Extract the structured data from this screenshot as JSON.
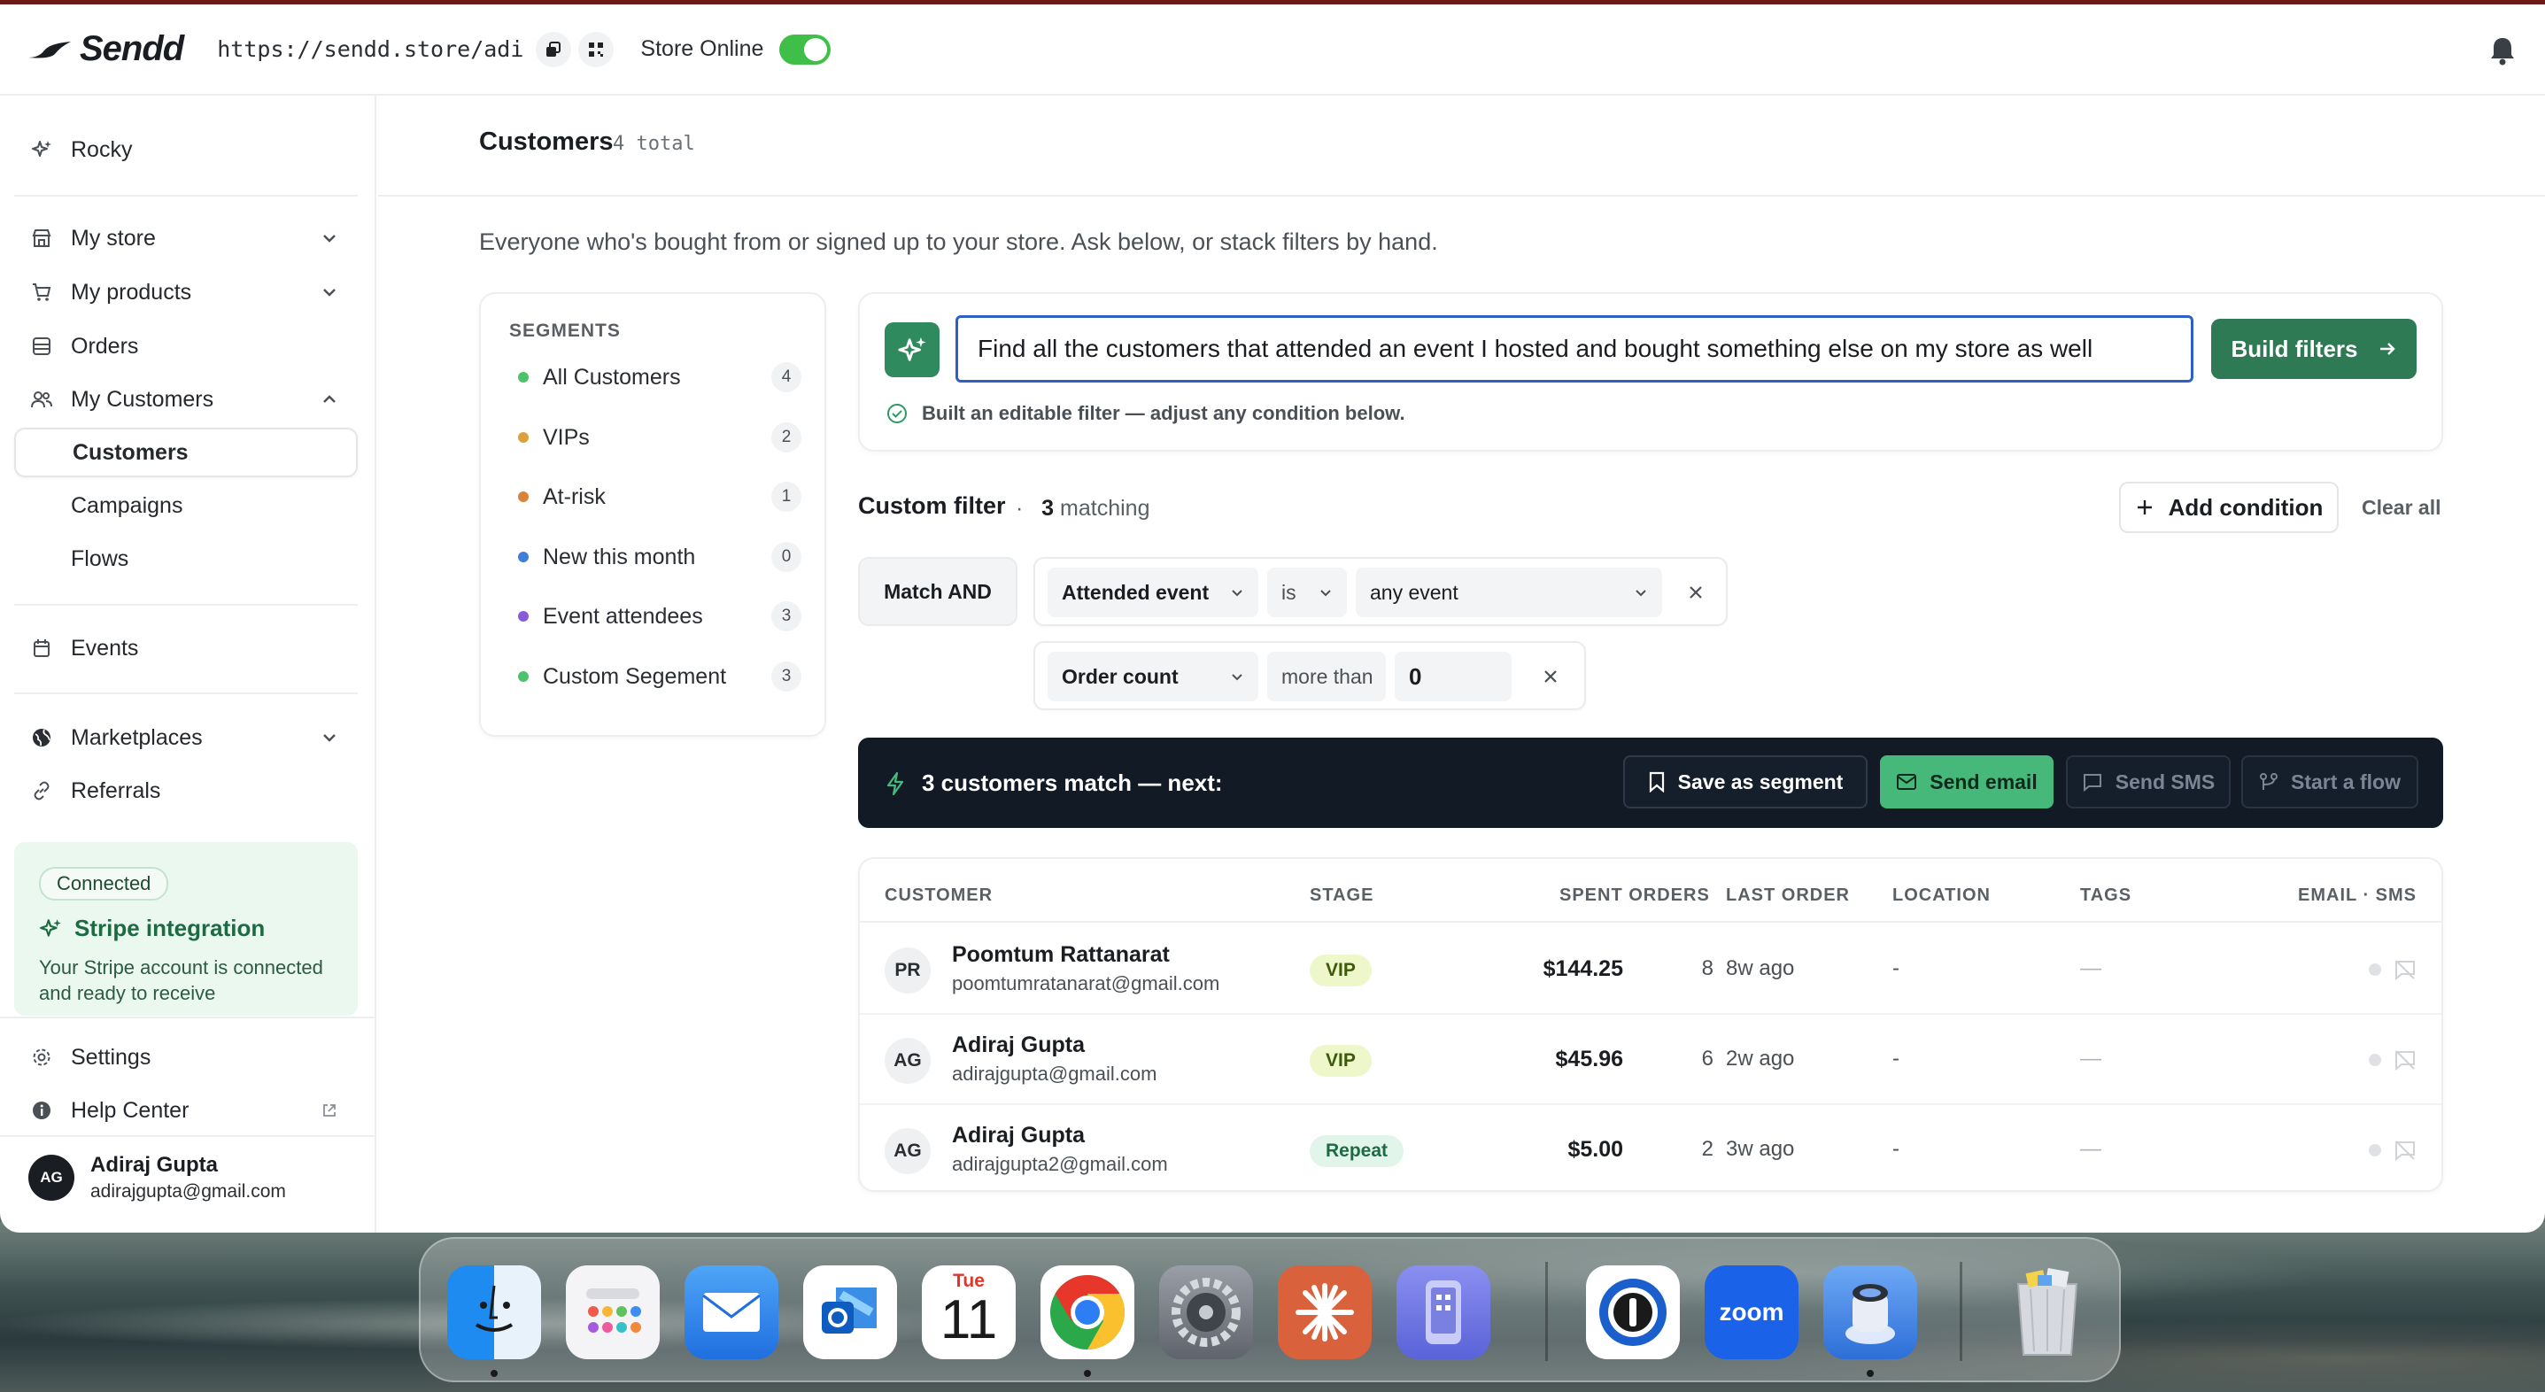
{
  "app": {
    "logo_text": "Sendd",
    "store_url": "https://sendd.store/adi",
    "store_online_label": "Store Online",
    "store_online": true
  },
  "sidebar": {
    "rocky": "Rocky",
    "my_store": "My store",
    "my_products": "My products",
    "orders": "Orders",
    "my_customers": "My Customers",
    "customers": "Customers",
    "campaigns": "Campaigns",
    "flows": "Flows",
    "events": "Events",
    "marketplaces": "Marketplaces",
    "referrals": "Referrals",
    "stripe": {
      "badge": "Connected",
      "title": "Stripe integration",
      "desc": "Your Stripe account is connected and ready to receive"
    },
    "settings": "Settings",
    "help_center": "Help Center",
    "user": {
      "initials": "AG",
      "name": "Adiraj Gupta",
      "email": "adirajgupta@gmail.com"
    }
  },
  "page": {
    "title": "Customers",
    "count": "4 total",
    "description": "Everyone who's bought from or signed up to your store. Ask below, or stack filters by hand."
  },
  "segments": {
    "heading": "SEGMENTS",
    "items": [
      {
        "label": "All Customers",
        "count": "4",
        "color": "#4cc36a"
      },
      {
        "label": "VIPs",
        "count": "2",
        "color": "#d9a23a"
      },
      {
        "label": "At-risk",
        "count": "1",
        "color": "#d9823a"
      },
      {
        "label": "New this month",
        "count": "0",
        "color": "#3f7fd9"
      },
      {
        "label": "Event attendees",
        "count": "3",
        "color": "#8a5bd9"
      },
      {
        "label": "Custom Segement",
        "count": "3",
        "color": "#4cc36a"
      }
    ]
  },
  "ai": {
    "query": "Find all the customers that attended an event I hosted and bought something else on my store as well",
    "build_label": "Build filters",
    "status": "Built an editable filter — adjust any condition below."
  },
  "filter": {
    "title": "Custom filter",
    "separator": "·",
    "matching_count": "3",
    "matching_label": "matching",
    "add_condition": "Add condition",
    "clear_all": "Clear all",
    "match_mode": "Match AND",
    "conditions": [
      {
        "field": "Attended event",
        "operator": "is",
        "value": "any event"
      },
      {
        "field": "Order count",
        "operator": "more than",
        "value": "0"
      }
    ]
  },
  "actions": {
    "summary": "3 customers match — next:",
    "save_segment": "Save as segment",
    "send_email": "Send email",
    "send_sms": "Send SMS",
    "start_flow": "Start a flow"
  },
  "table": {
    "headers": {
      "customer": "CUSTOMER",
      "stage": "STAGE",
      "spent_orders": "SPENT ORDERS",
      "last_order": "LAST ORDER",
      "location": "LOCATION",
      "tags": "TAGS",
      "email_sms": "EMAIL · SMS"
    },
    "rows": [
      {
        "initials": "PR",
        "name": "Poomtum Rattanarat",
        "email": "poomtumratanarat@gmail.com",
        "stage": "VIP",
        "spent": "$144.25",
        "orders": "8",
        "last_order": "8w ago",
        "location": "-",
        "tags": "—"
      },
      {
        "initials": "AG",
        "name": "Adiraj Gupta",
        "email": "adirajgupta@gmail.com",
        "stage": "VIP",
        "spent": "$45.96",
        "orders": "6",
        "last_order": "2w ago",
        "location": "-",
        "tags": "—"
      },
      {
        "initials": "AG",
        "name": "Adiraj Gupta",
        "email": "adirajgupta2@gmail.com",
        "stage": "Repeat",
        "spent": "$5.00",
        "orders": "2",
        "last_order": "3w ago",
        "location": "-",
        "tags": "—"
      }
    ]
  },
  "dock": {
    "calendar_day": "Tue",
    "calendar_date": "11",
    "zoom_label": "zoom"
  }
}
